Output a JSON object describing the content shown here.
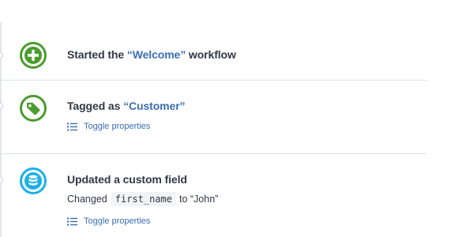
{
  "colors": {
    "green": "#4a9c2d",
    "cyan": "#1ab0e6",
    "link_blue": "#3a6eb5",
    "text": "#2f3a46"
  },
  "events": [
    {
      "icon": "plus-circle-icon",
      "title_prefix": "Started the ",
      "title_quoted": "“Welcome”",
      "title_suffix": " workflow"
    },
    {
      "icon": "tag-icon",
      "title_prefix": "Tagged as ",
      "title_quoted": "“Customer”",
      "toggle_label": "Toggle properties"
    },
    {
      "icon": "database-icon",
      "title_prefix": "Updated a custom field",
      "changed_prefix": "Changed",
      "field_name": "first_name",
      "changed_suffix": "to “John”",
      "toggle_label": "Toggle properties"
    }
  ]
}
